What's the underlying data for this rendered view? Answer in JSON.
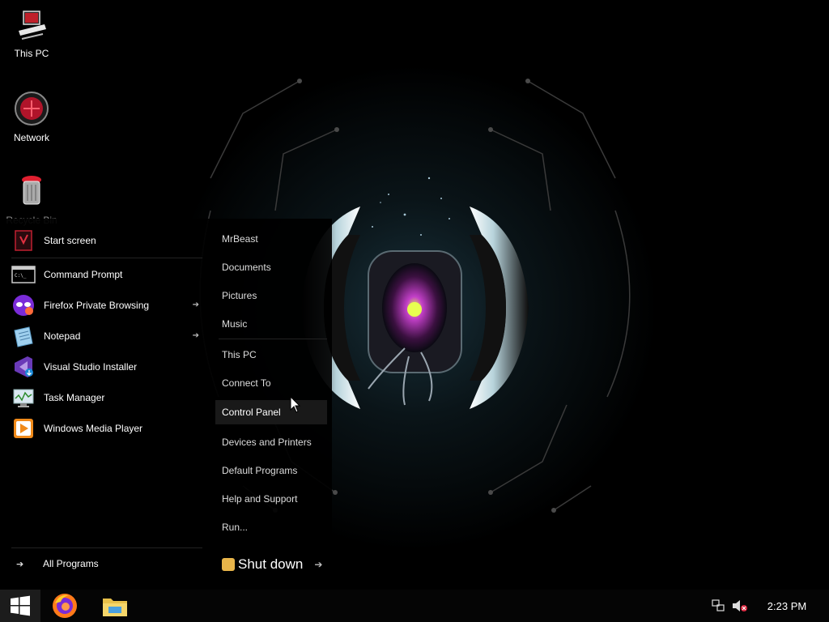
{
  "desktop": {
    "icons": [
      {
        "label": "This PC",
        "icon": "this-pc-icon"
      },
      {
        "label": "Network",
        "icon": "network-icon"
      },
      {
        "label": "Recycle Bin",
        "icon": "recycle-bin-icon"
      }
    ]
  },
  "start_menu": {
    "programs": [
      {
        "label": "Start screen",
        "icon": "start-screen-icon",
        "has_arrow": false
      },
      {
        "label": "Command Prompt",
        "icon": "command-prompt-icon",
        "has_arrow": false
      },
      {
        "label": "Firefox Private Browsing",
        "icon": "firefox-private-icon",
        "has_arrow": true
      },
      {
        "label": "Notepad",
        "icon": "notepad-icon",
        "has_arrow": true
      },
      {
        "label": "Visual Studio Installer",
        "icon": "visual-studio-installer-icon",
        "has_arrow": false
      },
      {
        "label": "Task Manager",
        "icon": "task-manager-icon",
        "has_arrow": false
      },
      {
        "label": "Windows Media Player",
        "icon": "windows-media-player-icon",
        "has_arrow": false
      }
    ],
    "all_programs_label": "All Programs",
    "places": [
      {
        "label": "MrBeast"
      },
      {
        "label": "Documents"
      },
      {
        "label": "Pictures"
      },
      {
        "label": "Music"
      },
      {
        "label": "This PC"
      },
      {
        "label": "Connect To"
      },
      {
        "label": "Control Panel",
        "highlighted": true
      },
      {
        "label": "Devices and Printers"
      },
      {
        "label": "Default Programs"
      },
      {
        "label": "Help and Support"
      },
      {
        "label": "Run..."
      }
    ],
    "shutdown_label": "Shut down"
  },
  "taskbar": {
    "start_icon": "windows-logo-icon",
    "pinned": [
      {
        "name": "Firefox",
        "icon": "firefox-icon"
      },
      {
        "name": "File Explorer",
        "icon": "file-explorer-icon"
      }
    ],
    "tray": {
      "network_icon": "network-tray-icon",
      "volume_icon": "volume-muted-icon",
      "clock": "2:23 PM"
    }
  },
  "colors": {
    "background": "#000000",
    "menu_background": "#0a0a0a",
    "highlight": "#191919",
    "accent_red": "#d7263d",
    "wallpaper_glow": "#cfeeff",
    "core_purple": "#b03ab8",
    "core_green": "#c8e63a"
  }
}
